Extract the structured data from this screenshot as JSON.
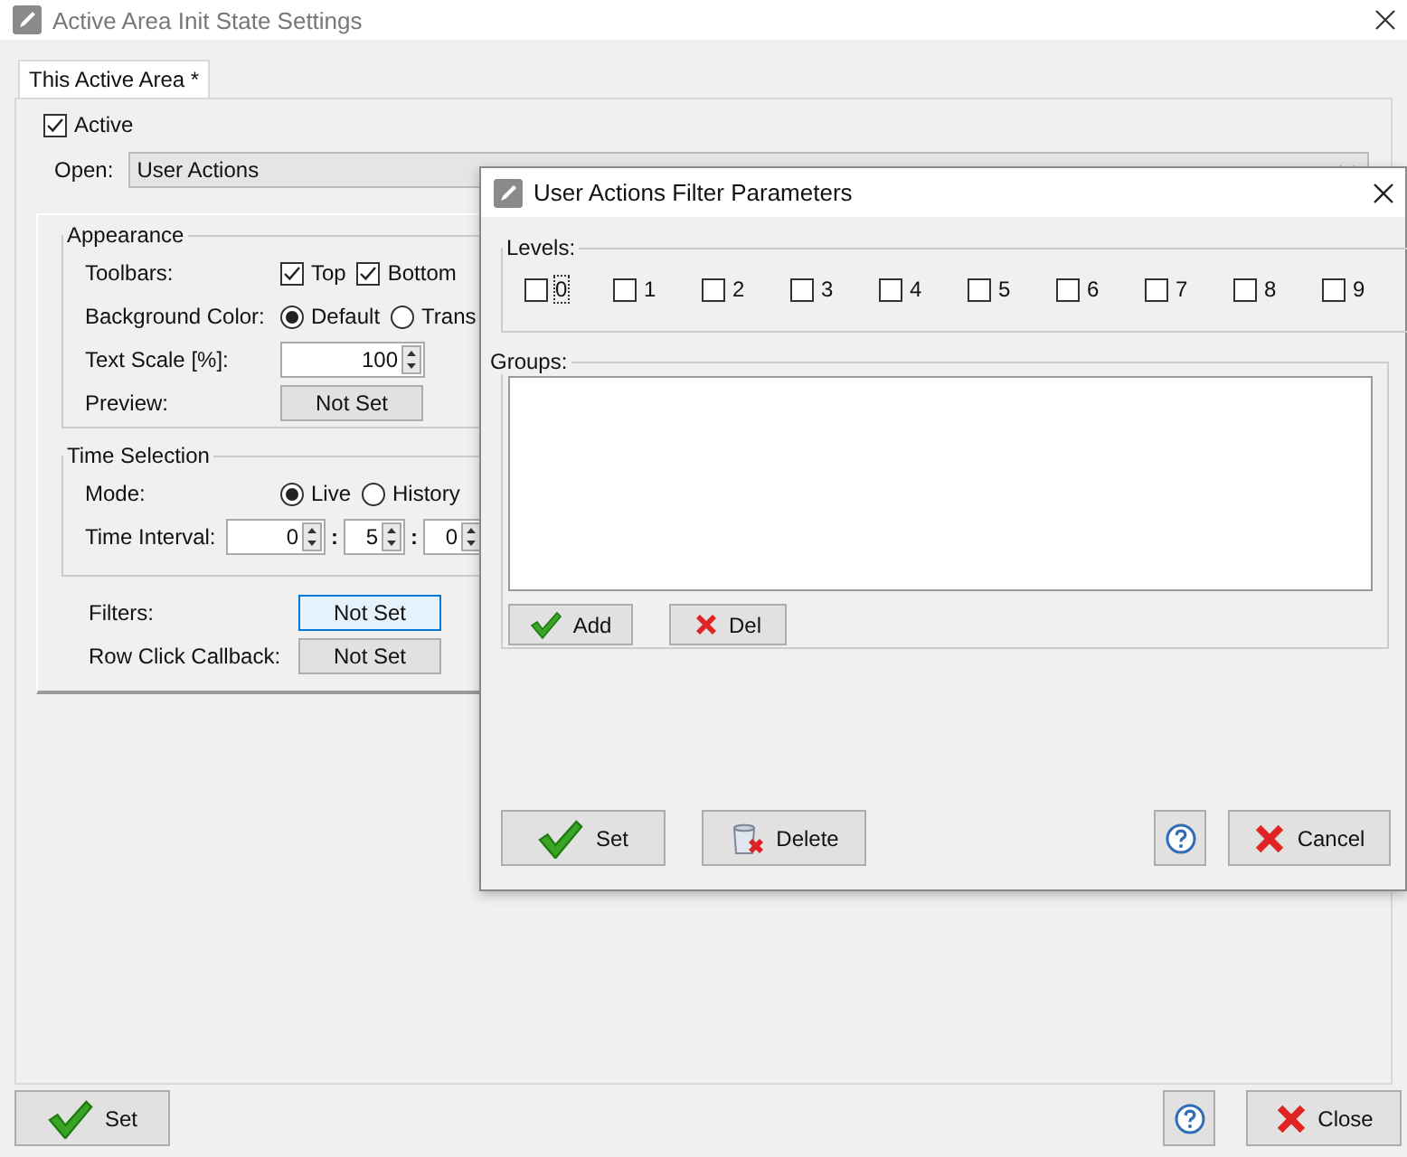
{
  "window": {
    "title": "Active Area Init State Settings"
  },
  "tabs": [
    {
      "label": "This Active Area *",
      "selected": true
    }
  ],
  "active": {
    "label": "Active",
    "checked": true
  },
  "open": {
    "label": "Open:",
    "value": "User Actions"
  },
  "appearance": {
    "title": "Appearance",
    "toolbars": {
      "label": "Toolbars:",
      "options": [
        {
          "label": "Top",
          "checked": true
        },
        {
          "label": "Bottom",
          "checked": true
        }
      ]
    },
    "background": {
      "label": "Background Color:",
      "options": [
        {
          "label": "Default",
          "selected": true
        },
        {
          "label": "Trans",
          "selected": false
        }
      ]
    },
    "text_scale": {
      "label": "Text Scale [%]:",
      "value": "100"
    },
    "preview": {
      "label": "Preview:",
      "button": "Not Set"
    }
  },
  "time_selection": {
    "title": "Time Selection",
    "mode": {
      "label": "Mode:",
      "options": [
        {
          "label": "Live",
          "selected": true
        },
        {
          "label": "History",
          "selected": false
        }
      ]
    },
    "interval": {
      "label": "Time Interval:",
      "fields": [
        "0",
        "5",
        "0"
      ],
      "separators": [
        ":",
        ":"
      ]
    }
  },
  "filters": {
    "label": "Filters:",
    "button": "Not Set",
    "highlighted": true
  },
  "row_click": {
    "label": "Row Click Callback:",
    "button": "Not Set",
    "highlighted": false
  },
  "buttons": [
    {
      "kind": "set",
      "label": "Set"
    },
    {
      "kind": "help"
    },
    {
      "kind": "close",
      "label": "Close"
    }
  ],
  "dialog": {
    "title": "User Actions Filter Parameters",
    "levels": {
      "title": "Levels:",
      "items": [
        {
          "label": "0",
          "checked": false,
          "focused": true
        },
        {
          "label": "1",
          "checked": false,
          "focused": false
        },
        {
          "label": "2",
          "checked": false,
          "focused": false
        },
        {
          "label": "3",
          "checked": false,
          "focused": false
        },
        {
          "label": "4",
          "checked": false,
          "focused": false
        },
        {
          "label": "5",
          "checked": false,
          "focused": false
        },
        {
          "label": "6",
          "checked": false,
          "focused": false
        },
        {
          "label": "7",
          "checked": false,
          "focused": false
        },
        {
          "label": "8",
          "checked": false,
          "focused": false
        },
        {
          "label": "9",
          "checked": false,
          "focused": false
        }
      ]
    },
    "groups": {
      "title": "Groups:",
      "buttons": [
        {
          "kind": "add",
          "label": "Add"
        },
        {
          "kind": "del",
          "label": "Del"
        }
      ]
    },
    "buttons": [
      {
        "kind": "set",
        "label": "Set"
      },
      {
        "kind": "delete",
        "label": "Delete"
      },
      {
        "kind": "help"
      },
      {
        "kind": "cancel",
        "label": "Cancel"
      }
    ]
  }
}
